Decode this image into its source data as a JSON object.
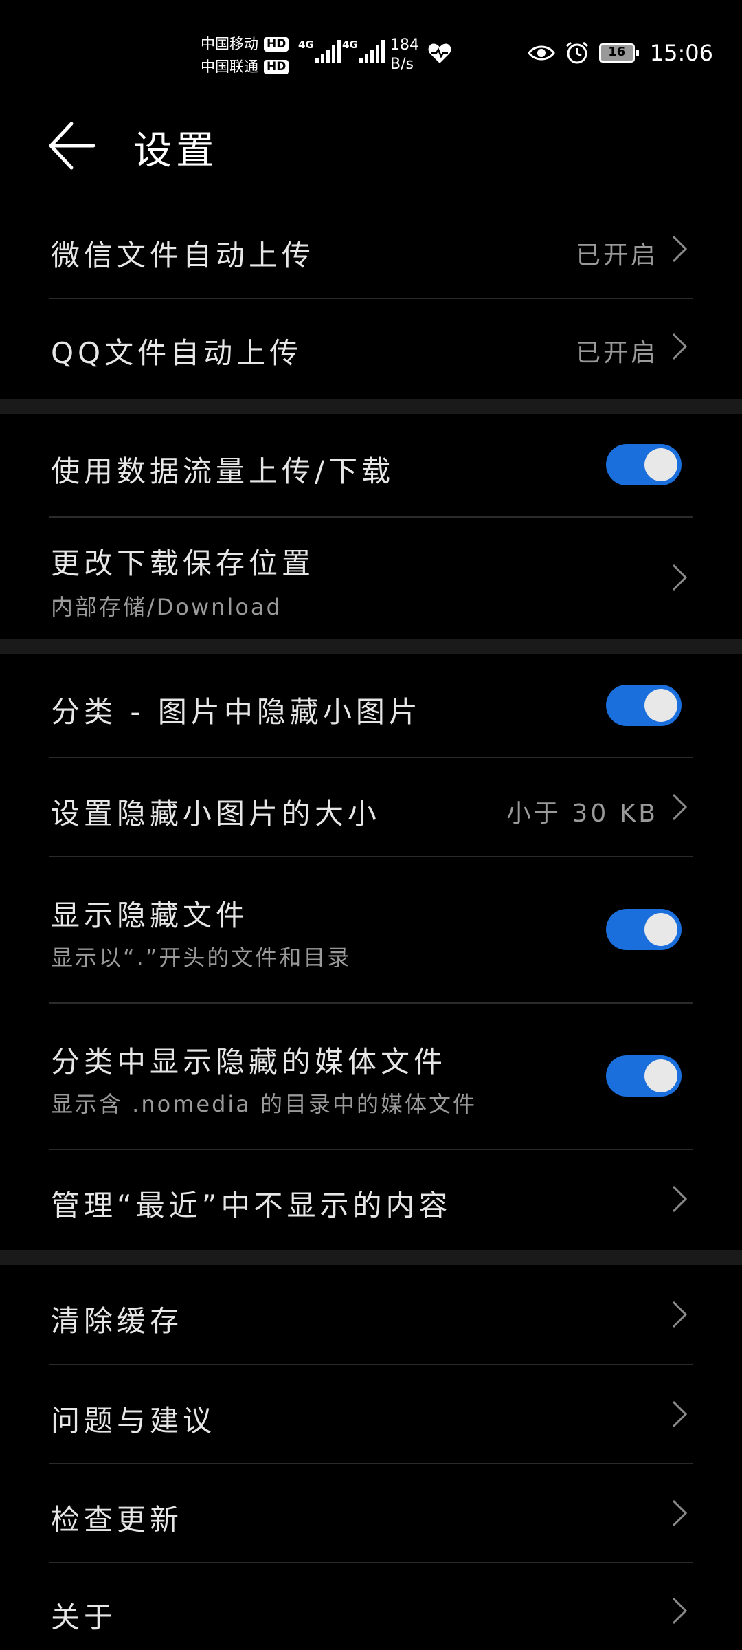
{
  "status_bar": {
    "carrier1": "中国移动",
    "carrier2": "中国联通",
    "hd_label": "HD",
    "network1": "4G",
    "network2": "4G",
    "speed_value": "184",
    "speed_unit": "B/s",
    "battery": "16",
    "time": "15:06",
    "icons": [
      "heart-rate-icon",
      "eye-icon",
      "alarm-icon",
      "battery-icon"
    ]
  },
  "header": {
    "title": "设置",
    "back_icon": "arrow-left-icon"
  },
  "settings": {
    "wechat_upload": {
      "label": "微信文件自动上传",
      "value": "已开启"
    },
    "qq_upload": {
      "label": "QQ文件自动上传",
      "value": "已开启"
    },
    "mobile_data": {
      "label": "使用数据流量上传/下载",
      "enabled": true
    },
    "download_location": {
      "label": "更改下载保存位置",
      "sub": "内部存储/Download"
    },
    "hide_small_images": {
      "label": "分类 - 图片中隐藏小图片",
      "enabled": true
    },
    "small_image_size": {
      "label": "设置隐藏小图片的大小",
      "value": "小于 30 KB"
    },
    "show_hidden_files": {
      "label": "显示隐藏文件",
      "sub": "显示以“.”开头的文件和目录",
      "enabled": true
    },
    "show_hidden_media": {
      "label": "分类中显示隐藏的媒体文件",
      "sub": "显示含 .nomedia 的目录中的媒体文件",
      "enabled": true
    },
    "manage_recent": {
      "label": "管理“最近”中不显示的内容"
    },
    "clear_cache": {
      "label": "清除缓存"
    },
    "feedback": {
      "label": "问题与建议"
    },
    "check_update": {
      "label": "检查更新"
    },
    "about": {
      "label": "关于"
    }
  },
  "colors": {
    "background": "#000000",
    "toggle_on": "#1a6fdc",
    "text_primary": "#e6e6e6",
    "text_secondary": "#9a9a9a",
    "section_gap": "#1a1a1a"
  }
}
